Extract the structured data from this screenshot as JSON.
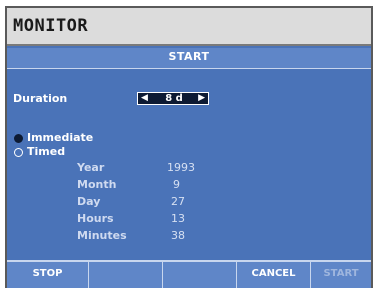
{
  "window": {
    "title": "MONITOR"
  },
  "panel": {
    "header": "START"
  },
  "duration": {
    "label": "Duration",
    "value": "8 d"
  },
  "mode": {
    "options": [
      {
        "label": "Immediate",
        "selected": true
      },
      {
        "label": "Timed",
        "selected": false
      }
    ]
  },
  "timed_fields": [
    {
      "label": "Year",
      "value": "1993"
    },
    {
      "label": "Month",
      "value": "9"
    },
    {
      "label": "Day",
      "value": "27"
    },
    {
      "label": "Hours",
      "value": "13"
    },
    {
      "label": "Minutes",
      "value": "38"
    }
  ],
  "footer": {
    "buttons": [
      {
        "label": "STOP",
        "enabled": true
      },
      {
        "label": "",
        "enabled": true
      },
      {
        "label": "",
        "enabled": true
      },
      {
        "label": "CANCEL",
        "enabled": true
      },
      {
        "label": "START",
        "enabled": false
      }
    ]
  }
}
